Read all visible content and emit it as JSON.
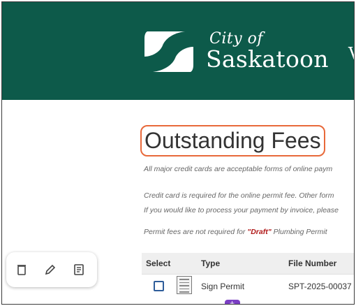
{
  "header": {
    "logo_line1": "City of",
    "logo_line2": "Saskatoon",
    "cut_letter": "V"
  },
  "page": {
    "title": "Outstanding Fees",
    "notes": [
      "All major credit cards are acceptable forms of online paym",
      "Credit card is required for the online permit fee. Other form",
      "If you would like to process your payment by invoice, please",
      "Permit fees are not required for"
    ],
    "draft_label": "\"Draft\"",
    "draft_suffix": "Plumbing Permit"
  },
  "table": {
    "columns": [
      "Select",
      "Type",
      "File Number"
    ],
    "rows": [
      {
        "type": "Sign Permit",
        "file_number": "SPT-2025-00037"
      }
    ]
  },
  "toolbar": {
    "icons": [
      "trash-icon",
      "pencil-icon",
      "notes-icon"
    ]
  },
  "colors": {
    "brand": "#0d5a4a",
    "highlight": "#e8693a",
    "draft": "#b01818",
    "tab": "#7b3fc4"
  }
}
